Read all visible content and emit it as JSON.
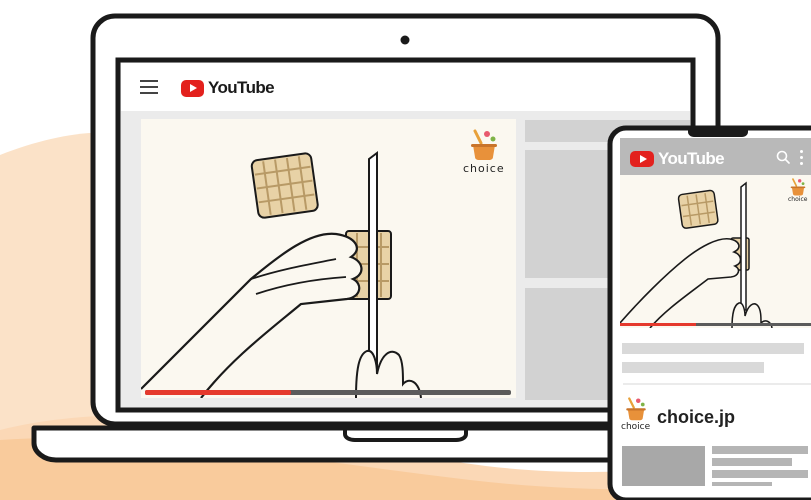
{
  "colors": {
    "accent_red": "#e3211d",
    "progress_red": "#e5392d",
    "frame": "#1a1a1a",
    "placeholder_gray": "#d9d9d9",
    "page_gray": "#ebebeb",
    "video_bg": "#fbf8f0",
    "background_peach": "#fbe0c6"
  },
  "laptop": {
    "header": {
      "menu_icon": "hamburger-menu-icon",
      "logo_text": "YouTube"
    },
    "video": {
      "channel_logo_text": "choice",
      "progress": 0.4
    }
  },
  "phone": {
    "header": {
      "logo_text": "YouTube",
      "search_icon": "search-icon",
      "more_icon": "more-vertical-icon"
    },
    "video": {
      "channel_logo_text": "choice",
      "progress": 0.4
    },
    "channel": {
      "logo_text": "choice",
      "name": "choice.jp"
    }
  }
}
